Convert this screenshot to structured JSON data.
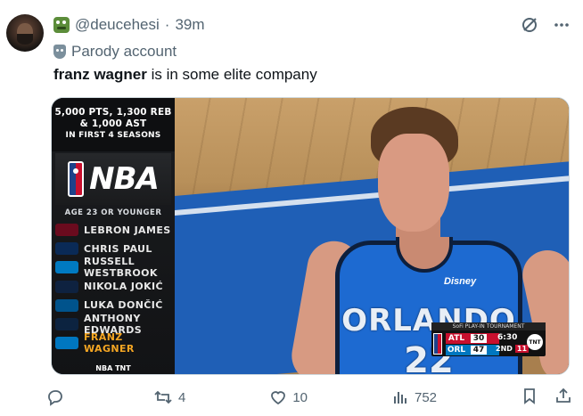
{
  "tweet": {
    "handle": "@deucehesi",
    "separator": "·",
    "time": "39m",
    "parody_label": "Parody account",
    "text_bold": "franz wagner",
    "text_rest": " is in some elite company"
  },
  "graphic": {
    "headline_line1": "5,000 PTS, 1,300 REB",
    "headline_line2": "& 1,000 AST",
    "headline_line3": "IN FIRST 4 SEASONS",
    "brand": "NBA",
    "age_label": "AGE 23 OR YOUNGER",
    "players": [
      {
        "name": "LEBRON JAMES",
        "color": "#6a0b1e",
        "highlight": false
      },
      {
        "name": "CHRIS PAUL",
        "color": "#0a2a56",
        "highlight": false
      },
      {
        "name": "RUSSELL WESTBROOK",
        "color": "#007ac1",
        "highlight": false
      },
      {
        "name": "NIKOLA JOKIĆ",
        "color": "#0e2240",
        "highlight": false
      },
      {
        "name": "LUKA DONČIĆ",
        "color": "#00538c",
        "highlight": false
      },
      {
        "name": "ANTHONY EDWARDS",
        "color": "#0c2340",
        "highlight": false
      },
      {
        "name": "FRANZ WAGNER",
        "color": "#0077c0",
        "highlight": true
      }
    ],
    "footer": "NBA TNT"
  },
  "photo": {
    "jersey_team": "ORLANDO",
    "jersey_number": "22",
    "sponsor": "Disney"
  },
  "scorebug": {
    "tournament": "SoFi PLAY-IN TOURNAMENT",
    "team1": "ATL",
    "score1": "30",
    "team2": "ORL",
    "score2": "47",
    "clock": "6:30",
    "quarter": "2ND",
    "shot_clock": "11",
    "network": "TNT"
  },
  "actions": {
    "replies": "",
    "reposts": "4",
    "likes": "10",
    "views": "752"
  }
}
